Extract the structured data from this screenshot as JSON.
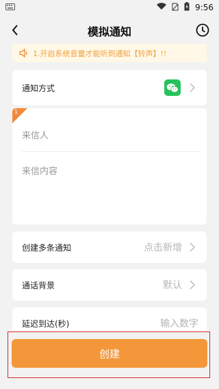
{
  "status": {
    "time": "9:56"
  },
  "header": {
    "title": "模拟通知"
  },
  "notice": {
    "text": "1.开启系统音量才能听到通知【铃声】!!"
  },
  "notify_method": {
    "label": "通知方式"
  },
  "message": {
    "badge_number": "1",
    "sender_placeholder": "来信人",
    "content_placeholder": "来信内容"
  },
  "multi_notify": {
    "label": "创建多条通知",
    "value": "点击新增"
  },
  "call_background": {
    "label": "通话背景",
    "value": "默认"
  },
  "delay": {
    "label": "延迟到达(秒)",
    "placeholder": "输入数字"
  },
  "create_button": {
    "label": "创建"
  },
  "colors": {
    "accent": "#f4973a",
    "wechat": "#26c25c",
    "highlight_border": "#d8272e"
  }
}
